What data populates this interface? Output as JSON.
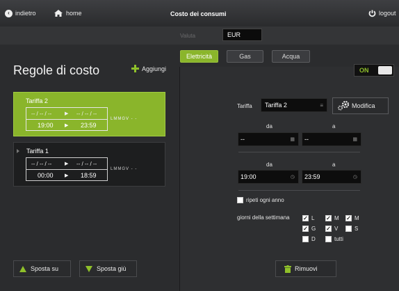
{
  "topbar": {
    "back_label": "indietro",
    "home_label": "home",
    "title": "Costo dei consumi",
    "logout_label": "logout"
  },
  "valuta": {
    "label": "Valuta",
    "value": "EUR"
  },
  "tabs": [
    {
      "label": "Elettricità",
      "active": true
    },
    {
      "label": "Gas",
      "active": false
    },
    {
      "label": "Acqua",
      "active": false
    }
  ],
  "left": {
    "heading": "Regole di costo",
    "add_label": "Aggiungi",
    "tariffs": [
      {
        "name": "Tariffa 2",
        "date_from": "-- / -- / --",
        "date_to": "-- / -- / --",
        "time_from": "19:00",
        "time_to": "23:59",
        "days": "LMMGV - -",
        "selected": true
      },
      {
        "name": "Tariffa 1",
        "date_from": "-- / -- / --",
        "date_to": "-- / -- / --",
        "time_from": "00:00",
        "time_to": "18:59",
        "days": "LMMGV - -",
        "selected": false
      }
    ],
    "move_up_label": "Sposta su",
    "move_down_label": "Sposta giù",
    "arrow_glyph": "▶"
  },
  "right": {
    "toggle_label": "ON",
    "tariffa_label": "Tariffa",
    "tariffa_value": "Tariffa 2",
    "modifica_label": "Modifica",
    "date_from_label": "da",
    "date_to_label": "a",
    "date_from_value": "--",
    "date_to_value": "--",
    "time_from_label": "da",
    "time_to_label": "a",
    "time_from_value": "19:00",
    "time_to_value": "23:59",
    "repeat_label": "ripeti ogni anno",
    "repeat_checked": false,
    "days_label": "giorni della settimana",
    "days": [
      {
        "label": "L",
        "checked": true
      },
      {
        "label": "M",
        "checked": true
      },
      {
        "label": "M",
        "checked": true
      },
      {
        "label": "G",
        "checked": true
      },
      {
        "label": "V",
        "checked": true
      },
      {
        "label": "S",
        "checked": false
      },
      {
        "label": "D",
        "checked": false
      },
      {
        "label": "tutti",
        "checked": false
      }
    ],
    "remove_label": "Rimuovi"
  },
  "icons": {
    "back": "back-circle-icon",
    "home": "home-icon",
    "logout": "power-icon",
    "add": "plus-icon",
    "modifica": "gears-icon",
    "remove": "trash-icon",
    "calendar": "calendar-icon",
    "clock": "clock-icon",
    "list": "list-icon"
  },
  "colors": {
    "accent": "#8ab52b",
    "background": "#2e2f31"
  }
}
